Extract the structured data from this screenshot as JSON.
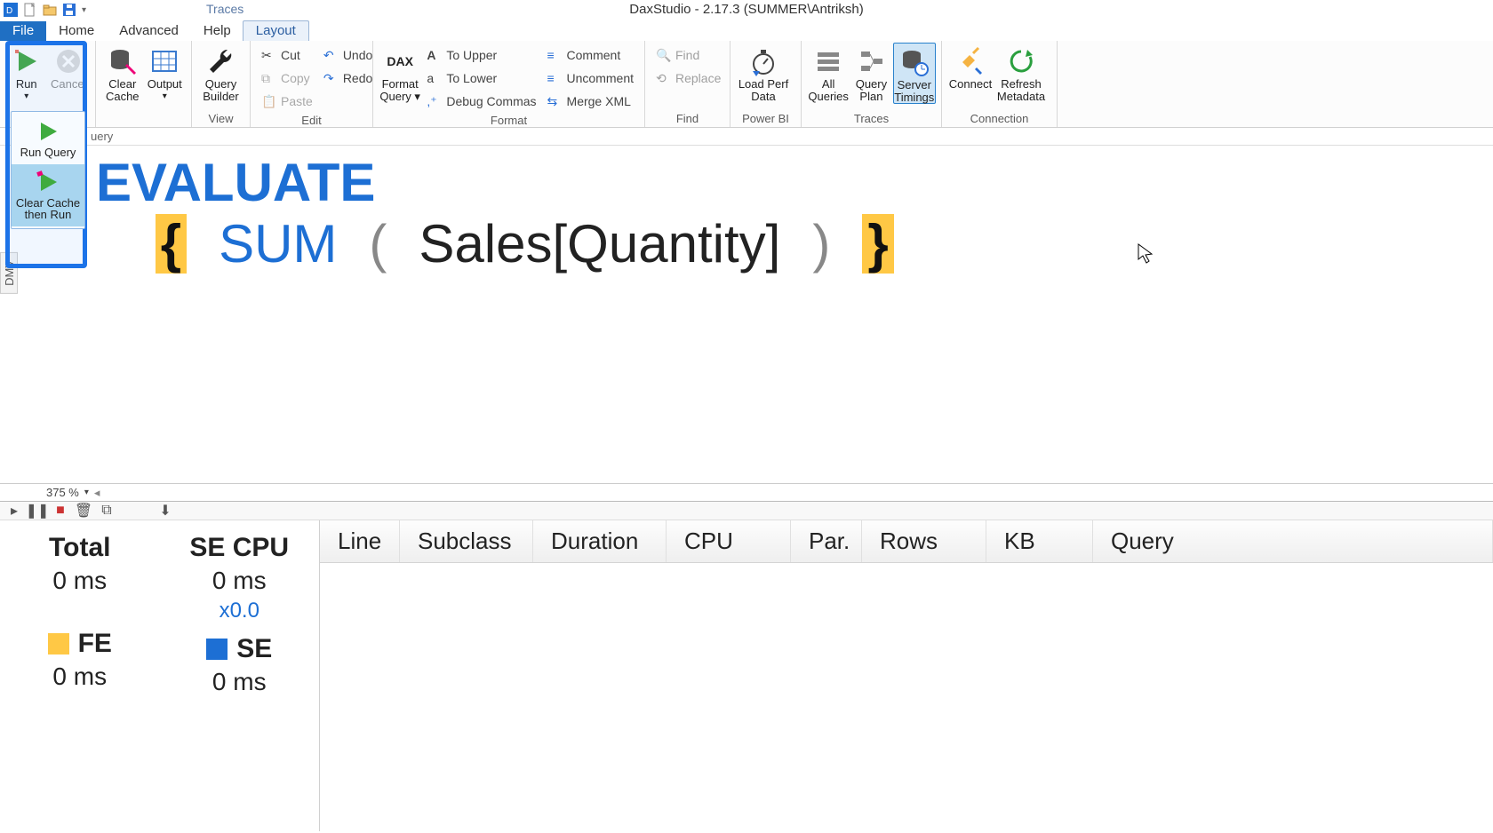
{
  "app": {
    "title": "DaxStudio - 2.17.3 (SUMMER\\Antriksh)"
  },
  "context_header": "Traces",
  "menu": {
    "file": "File",
    "home": "Home",
    "advanced": "Advanced",
    "help": "Help",
    "layout": "Layout"
  },
  "doc_tab": "uery",
  "ribbon": {
    "run": {
      "label": "Run",
      "drop": "▾",
      "group": ""
    },
    "cancel": "Cancel",
    "clear_cache": "Clear\nCache",
    "output": "Output",
    "query_builder": "Query\nBuilder",
    "view_group": "View",
    "cut": "Cut",
    "copy": "Copy",
    "paste": "Paste",
    "undo": "Undo",
    "redo": "Redo",
    "edit_group": "Edit",
    "format_query": "Format\nQuery ▾",
    "to_upper": "To Upper",
    "to_lower": "To Lower",
    "debug_commas": "Debug Commas",
    "comment": "Comment",
    "uncomment": "Uncomment",
    "merge_xml": "Merge XML",
    "format_group": "Format",
    "find": "Find",
    "replace": "Replace",
    "find_group": "Find",
    "load_perf": "Load Perf\nData",
    "powerbi_group": "Power BI",
    "all_queries": "All\nQueries",
    "query_plan": "Query\nPlan",
    "server_timings": "Server\nTimings",
    "traces_group": "Traces",
    "connect": "Connect",
    "refresh_meta": "Refresh\nMetadata",
    "connection_group": "Connection"
  },
  "run_dropdown": {
    "run_query": "Run Query",
    "clear_then_run": "Clear Cache\nthen Run"
  },
  "side_tab": "DMV",
  "code": {
    "evaluate": "EVALUATE",
    "indent": "    ",
    "lbrace": "{",
    "sum": "SUM",
    "lpar": "(",
    "expr": "Sales[Quantity]",
    "rpar": ")",
    "rbrace": "}"
  },
  "zoom": "375 %",
  "summary": {
    "total_label": "Total",
    "total_val": "0 ms",
    "secpu_label": "SE CPU",
    "secpu_val": "0 ms",
    "secpu_mult": "x0.0",
    "fe_label": "FE",
    "fe_val": "0 ms",
    "fe_color": "#ffc845",
    "se_label": "SE",
    "se_val": "0 ms",
    "se_color": "#1d6fd4"
  },
  "grid_cols": {
    "line": "Line",
    "subclass": "Subclass",
    "duration": "Duration",
    "cpu": "CPU",
    "par": "Par.",
    "rows": "Rows",
    "kb": "KB",
    "query": "Query"
  }
}
